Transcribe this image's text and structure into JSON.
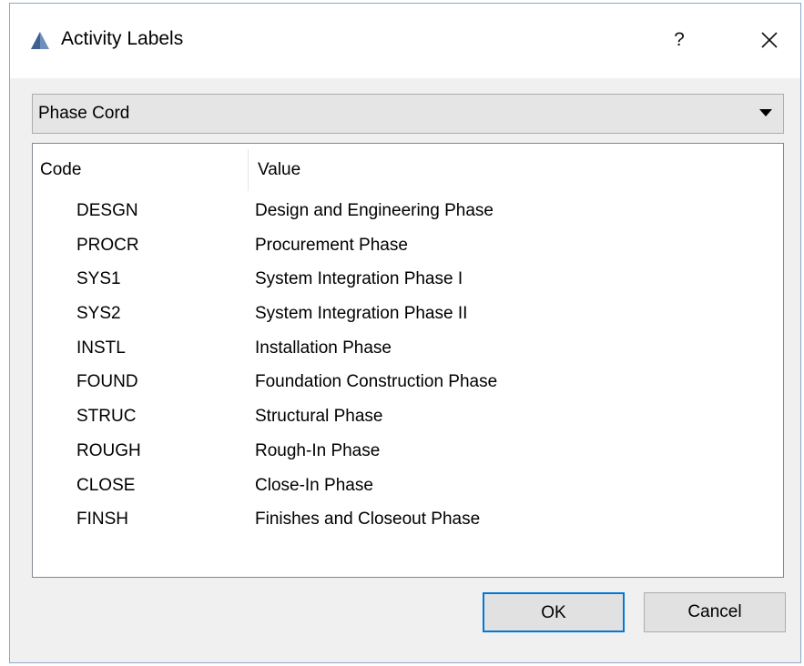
{
  "window": {
    "title": "Activity Labels",
    "help_label": "?"
  },
  "combo": {
    "selected": "Phase Cord"
  },
  "list": {
    "headers": {
      "code": "Code",
      "value": "Value"
    },
    "rows": [
      {
        "code": "DESGN",
        "value": "Design and Engineering Phase"
      },
      {
        "code": "PROCR",
        "value": "Procurement Phase"
      },
      {
        "code": "SYS1",
        "value": "System Integration Phase I"
      },
      {
        "code": "SYS2",
        "value": "System Integration Phase II"
      },
      {
        "code": "INSTL",
        "value": "Installation Phase"
      },
      {
        "code": "FOUND",
        "value": "Foundation Construction Phase"
      },
      {
        "code": "STRUC",
        "value": "Structural Phase"
      },
      {
        "code": "ROUGH",
        "value": "Rough-In Phase"
      },
      {
        "code": "CLOSE",
        "value": "Close-In Phase"
      },
      {
        "code": "FINSH",
        "value": "Finishes and Closeout Phase"
      }
    ]
  },
  "buttons": {
    "ok_label": "OK",
    "cancel_label": "Cancel"
  },
  "colors": {
    "accent": "#0078d7",
    "dialog_bg": "#f0f0f0",
    "app_icon": "#4a6fa0"
  }
}
